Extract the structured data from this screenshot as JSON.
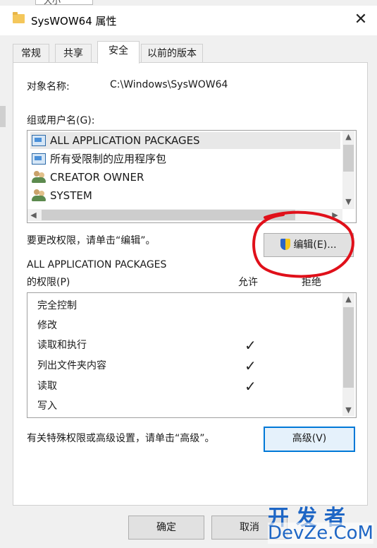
{
  "window": {
    "fragment_text": "大小",
    "title": "SysWOW64 属性",
    "close_glyph": "✕"
  },
  "tabs": [
    {
      "label": "常规"
    },
    {
      "label": "共享"
    },
    {
      "label": "安全",
      "active": true
    },
    {
      "label": "以前的版本"
    }
  ],
  "security": {
    "object_name_label": "对象名称:",
    "object_name_value": "C:\\Windows\\SysWOW64",
    "groups_label": "组或用户名(G):",
    "groups": [
      {
        "name": "ALL APPLICATION PACKAGES",
        "icon": "package-icon",
        "selected": true
      },
      {
        "name": "所有受限制的应用程序包",
        "icon": "package-icon"
      },
      {
        "name": "CREATOR OWNER",
        "icon": "user-group-icon"
      },
      {
        "name": "SYSTEM",
        "icon": "user-group-icon"
      }
    ],
    "change_hint": "要更改权限，请单击“编辑”。",
    "edit_button": "编辑(E)...",
    "perm_group_name": "ALL APPLICATION PACKAGES",
    "perm_label": "的权限(P)",
    "allow_header": "允许",
    "deny_header": "拒绝",
    "permissions": [
      {
        "name": "完全控制",
        "allow": false
      },
      {
        "name": "修改",
        "allow": false
      },
      {
        "name": "读取和执行",
        "allow": true
      },
      {
        "name": "列出文件夹内容",
        "allow": true
      },
      {
        "name": "读取",
        "allow": true
      },
      {
        "name": "写入",
        "allow": false
      }
    ],
    "check_glyph": "✓",
    "advanced_hint": "有关特殊权限或高级设置，请单击“高级”。",
    "advanced_button": "高级(V)"
  },
  "footer": {
    "ok_button": "确定",
    "cancel_button": "取消"
  },
  "watermark": {
    "cn": "开发者",
    "en": "DevZe.CoM"
  },
  "colors": {
    "annotation": "#e0101a",
    "focus": "#0078d7",
    "watermark": "#1e66c5"
  }
}
